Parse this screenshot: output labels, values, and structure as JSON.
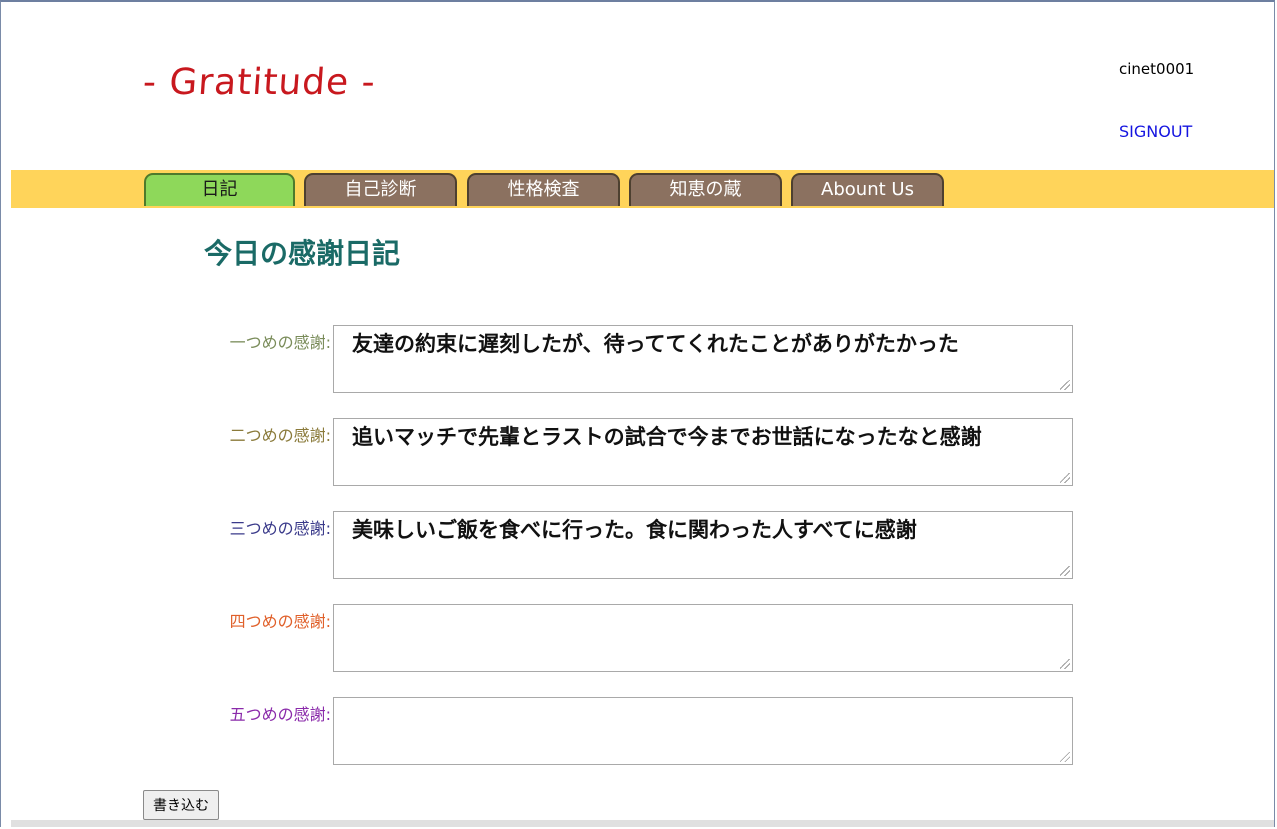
{
  "header": {
    "logo_text": "- Gratitude -",
    "user_name": "cinet0001",
    "signout_label": "SIGNOUT"
  },
  "nav": {
    "tabs": [
      {
        "label": "日記",
        "active": true
      },
      {
        "label": "自己診断",
        "active": false
      },
      {
        "label": "性格検査",
        "active": false
      },
      {
        "label": "知恵の蔵",
        "active": false
      },
      {
        "label": "Abount Us",
        "active": false
      }
    ]
  },
  "main": {
    "title": "今日の感謝日記",
    "entries": [
      {
        "label": "一つめの感謝:",
        "label_color": "#7a8c5a",
        "value": "友達の約束に遅刻したが、待っててくれたことがありがたかった"
      },
      {
        "label": "二つめの感謝:",
        "label_color": "#8a7a3a",
        "value": "追いマッチで先輩とラストの試合で今までお世話になったなと感謝"
      },
      {
        "label": "三つめの感謝:",
        "label_color": "#3a3a8a",
        "value": "美味しいご飯を食べに行った。食に関わった人すべてに感謝"
      },
      {
        "label": "四つめの感謝:",
        "label_color": "#e0602a",
        "value": ""
      },
      {
        "label": "五つめの感謝:",
        "label_color": "#8a2aaa",
        "value": ""
      }
    ],
    "submit_label": "書き込む"
  },
  "colors": {
    "nav_bar": "#ffd45a",
    "tab_inactive": "#8b7160",
    "tab_active": "#8ed85a",
    "title": "#1a6a66",
    "logo": "#c8181e",
    "signout": "#1515e0"
  }
}
